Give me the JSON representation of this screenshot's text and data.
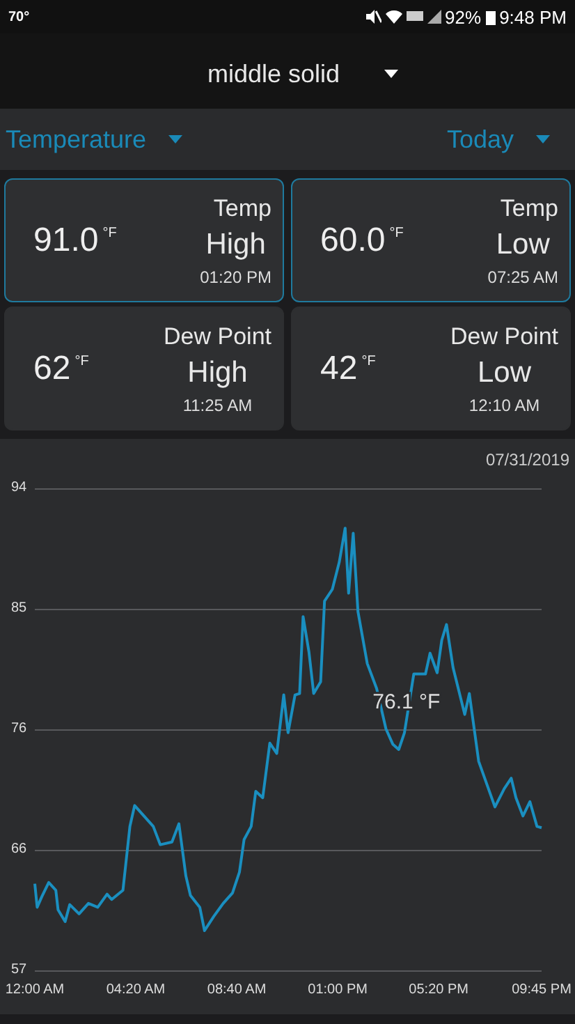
{
  "status_bar": {
    "temperature": "70°",
    "battery_percent": "92%",
    "time": "9:48 PM"
  },
  "header": {
    "station": "middle solid"
  },
  "filters": {
    "metric": "Temperature",
    "period": "Today"
  },
  "cards": [
    {
      "value": "91.0",
      "unit": "°F",
      "label": "Temp",
      "extreme": "High",
      "time": "01:20 PM",
      "selected": true
    },
    {
      "value": "60.0",
      "unit": "°F",
      "label": "Temp",
      "extreme": "Low",
      "time": "07:25 AM",
      "selected": true
    },
    {
      "value": "62",
      "unit": "°F",
      "label": "Dew Point",
      "extreme": "High",
      "time": "11:25 AM",
      "selected": false
    },
    {
      "value": "42",
      "unit": "°F",
      "label": "Dew Point",
      "extreme": "Low",
      "time": "12:10 AM",
      "selected": false
    }
  ],
  "chart": {
    "date": "07/31/2019",
    "chart_data": {
      "type": "line",
      "x": [
        0,
        6,
        18,
        36,
        54,
        60,
        78,
        90,
        114,
        138,
        162,
        186,
        198,
        227,
        245,
        257,
        305,
        323,
        353,
        371,
        389,
        401,
        425,
        437,
        461,
        485,
        509,
        527,
        539,
        557,
        569,
        587,
        605,
        623,
        641,
        652,
        670,
        682,
        691,
        706,
        718,
        736,
        746,
        766,
        784,
        799,
        808,
        820,
        832,
        856,
        880,
        904,
        922,
        937,
        952,
        976,
        1006,
        1018,
        1036,
        1048,
        1060,
        1077,
        1107,
        1119,
        1143,
        1185,
        1209,
        1227,
        1239,
        1257,
        1275,
        1293,
        1305
      ],
      "series": [
        {
          "color": "#1a8fc0",
          "values": [
            63.7,
            61.9,
            62.7,
            63.8,
            63.2,
            61.7,
            60.8,
            62.1,
            61.4,
            62.2,
            61.9,
            62.9,
            62.5,
            63.2,
            68.1,
            69.7,
            68.1,
            66.7,
            66.9,
            68.3,
            64.3,
            62.8,
            61.9,
            60.1,
            61.2,
            62.2,
            63.0,
            64.6,
            67.1,
            68.1,
            70.8,
            70.3,
            74.5,
            73.7,
            78.2,
            75.3,
            78.2,
            78.3,
            84.2,
            81.5,
            78.3,
            79.2,
            85.4,
            86.3,
            88.4,
            91.0,
            86.0,
            90.6,
            84.6,
            80.6,
            78.7,
            75.6,
            74.4,
            74.0,
            75.3,
            79.8,
            79.8,
            81.4,
            79.9,
            82.4,
            83.6,
            80.3,
            76.7,
            78.3,
            73.1,
            69.6,
            71.0,
            71.8,
            70.3,
            68.9,
            70.0,
            68.1,
            68.0
          ]
        }
      ],
      "grid": true,
      "xlim": [
        0,
        1305
      ],
      "ylim": [
        57,
        94
      ],
      "xticks": [
        {
          "value": 0,
          "label": "12:00 AM"
        },
        {
          "value": 260,
          "label": "04:20 AM"
        },
        {
          "value": 520,
          "label": "08:40 AM"
        },
        {
          "value": 780,
          "label": "01:00 PM"
        },
        {
          "value": 1040,
          "label": "05:20 PM"
        },
        {
          "value": 1305,
          "label": "09:45 PM"
        }
      ],
      "yticks": [
        {
          "value": 57,
          "label": "57"
        },
        {
          "value": 66.25,
          "label": "66"
        },
        {
          "value": 75.5,
          "label": "76"
        },
        {
          "value": 84.75,
          "label": "85"
        },
        {
          "value": 94,
          "label": "94"
        }
      ],
      "annotations": [
        {
          "x": 870,
          "y": 77.7,
          "text": "76.1 °F"
        }
      ]
    }
  }
}
